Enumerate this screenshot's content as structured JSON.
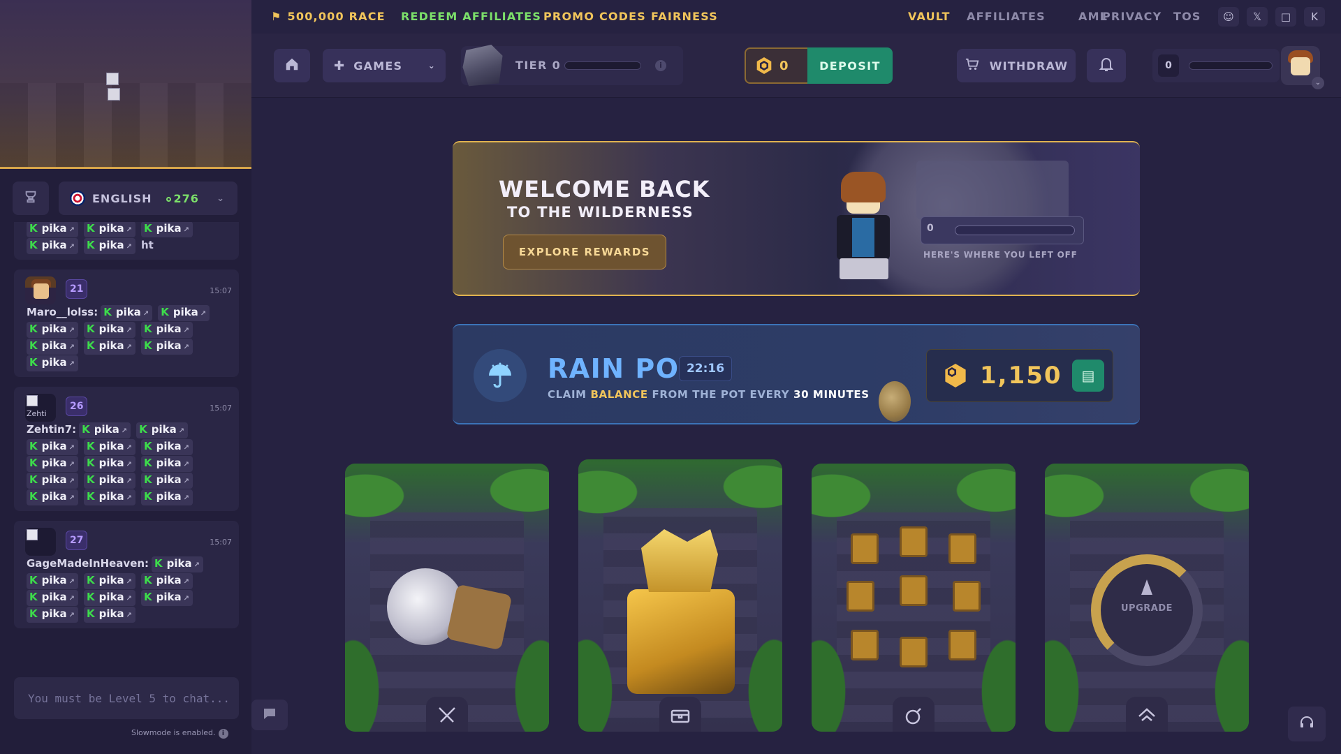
{
  "topnav": {
    "race": "500,000 RACE",
    "redeem": "REDEEM AFFILIATES",
    "promo": "PROMO CODES",
    "fairness": "FAIRNESS",
    "vault": "VAULT",
    "affiliates": "AFFILIATES",
    "aml": "AML",
    "privacy": "PRIVACY",
    "tos": "TOS",
    "social_icons": [
      "discord-icon",
      "x-icon",
      "chat-bubble-icon",
      "k-icon"
    ]
  },
  "header": {
    "games_label": "GAMES",
    "tier_label": "TIER 0",
    "tier_progress": 0,
    "balance": "0",
    "deposit_label": "DEPOSIT",
    "withdraw_label": "WITHDRAW",
    "xp_level": "0",
    "xp_progress": 0
  },
  "sidebar": {
    "language": "ENGLISH",
    "online_count": "276",
    "chat_placeholder": "You must be Level 5 to chat...",
    "slowmode": "Slowmode is enabled."
  },
  "chat": {
    "emote": "pika",
    "first_trailing_text": "ht",
    "messages": [
      {
        "user": "Maro__lolss:",
        "level": "21",
        "time": "15:07"
      },
      {
        "user": "Zehtin7:",
        "level": "26",
        "time": "15:07",
        "avatar_alt": "Zehti"
      },
      {
        "user": "GageMadeInHeaven:",
        "level": "27",
        "time": "15:07"
      }
    ]
  },
  "welcome": {
    "title": "WELCOME BACK",
    "subtitle": "TO THE WILDERNESS",
    "button": "EXPLORE REWARDS",
    "progress_value": "0",
    "left_off": "HERE'S WHERE YOU LEFT OFF"
  },
  "rain": {
    "title": "RAIN POT",
    "timer": "22:16",
    "sub_claim": "CLAIM ",
    "sub_balance": "BALANCE",
    "sub_mid": " FROM THE POT EVERY ",
    "sub_minutes": "30 MINUTES",
    "amount": "1,150"
  },
  "games": [
    {
      "name": "battles",
      "icon": "swords-icon"
    },
    {
      "name": "cases",
      "icon": "chest-icon"
    },
    {
      "name": "mines",
      "icon": "bomb-icon"
    },
    {
      "name": "upgrade",
      "icon": "upgrade-arrow-icon",
      "label": "UPGRADE"
    }
  ],
  "colors": {
    "accent_gold": "#f1c55b",
    "deposit_green": "#1f8a6b",
    "race_gold": "#f1c55b",
    "redeem_green": "#7ce06a",
    "rain_blue": "#6fb3ff",
    "background": "#262241"
  }
}
